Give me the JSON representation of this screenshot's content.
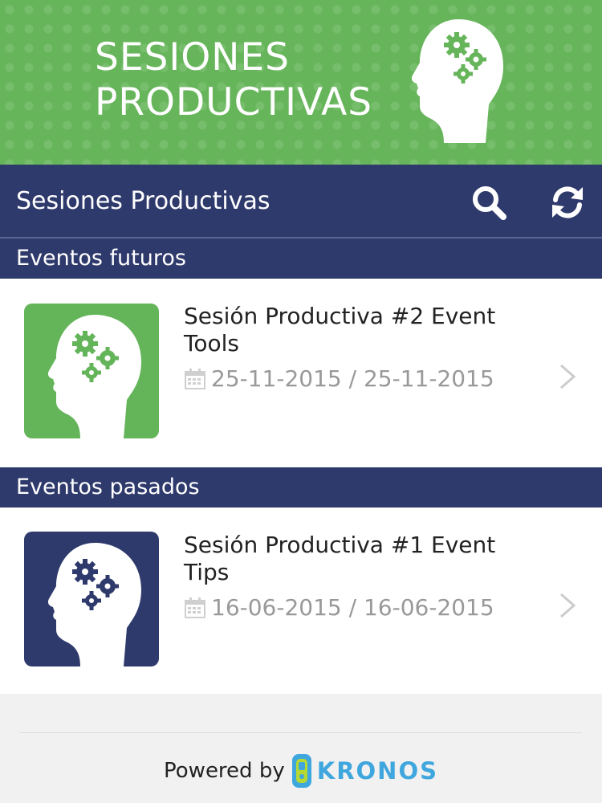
{
  "banner": {
    "title_line1": "SESIONES",
    "title_line2": "PRODUCTIVAS"
  },
  "toolbar": {
    "title": "Sesiones Productivas",
    "search_icon": "search-icon",
    "refresh_icon": "refresh-icon"
  },
  "sections": {
    "futuros": {
      "title": "Eventos futuros",
      "events": [
        {
          "title": "Sesión Productiva #2 Event Tools",
          "date": "25-11-2015 / 25-11-2015",
          "thumb_color": "#64b45a"
        }
      ]
    },
    "pasados": {
      "title": "Eventos pasados",
      "events": [
        {
          "title": "Sesión Productiva #1 Event Tips",
          "date": "16-06-2015 / 16-06-2015",
          "thumb_color": "#2f3a6c"
        }
      ]
    }
  },
  "footer": {
    "powered_by": "Powered by",
    "brand": "KRONOS"
  },
  "colors": {
    "banner_green": "#67b55b",
    "navy": "#2f3a6c",
    "brand_blue": "#3fa7de",
    "date_gray": "#999999"
  }
}
